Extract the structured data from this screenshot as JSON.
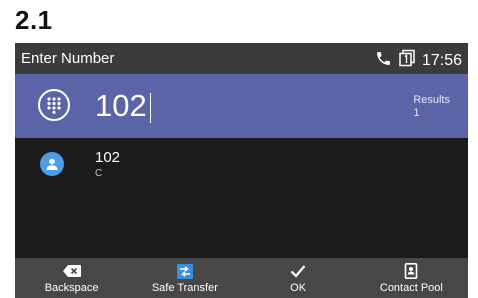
{
  "section_title": "2.1",
  "status_bar": {
    "title": "Enter Number",
    "time": "17:56"
  },
  "input": {
    "value": "102"
  },
  "results": {
    "label": "Results",
    "count": "1"
  },
  "result_item": {
    "name": "102",
    "sub": "C"
  },
  "softkeys": [
    {
      "label": "Backspace",
      "icon": "backspace-icon"
    },
    {
      "label": "Safe Transfer",
      "icon": "transfer-icon"
    },
    {
      "label": "OK",
      "icon": "check-icon"
    },
    {
      "label": "Contact Pool",
      "icon": "contact-book-icon"
    }
  ],
  "colors": {
    "status_bar": "#3b3b3b",
    "input_row": "#5a64a6",
    "background": "#1b1b1b",
    "softkey_bar": "#474747",
    "avatar": "#4a9ee6",
    "transfer_icon": "#3a8fe0"
  }
}
